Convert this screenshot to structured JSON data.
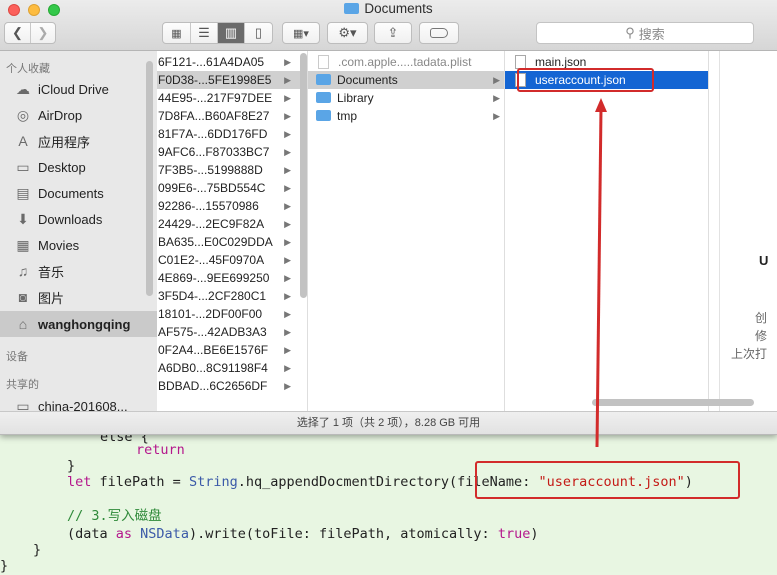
{
  "window": {
    "title": "Documents"
  },
  "toolbar": {
    "search_placeholder": "搜索"
  },
  "sidebar": {
    "favorites_header": "个人收藏",
    "devices_header": "设备",
    "shared_header": "共享的",
    "items": [
      {
        "label": "iCloud Drive",
        "icon": "☁"
      },
      {
        "label": "AirDrop",
        "icon": "◎"
      },
      {
        "label": "应用程序",
        "icon": "A"
      },
      {
        "label": "Desktop",
        "icon": "▭"
      },
      {
        "label": "Documents",
        "icon": "▤"
      },
      {
        "label": "Downloads",
        "icon": "⬇"
      },
      {
        "label": "Movies",
        "icon": "▦"
      },
      {
        "label": "音乐",
        "icon": "♫"
      },
      {
        "label": "图片",
        "icon": "◙"
      },
      {
        "label": "wanghongqing",
        "icon": "⌂"
      }
    ],
    "shared_item": "china-201608..."
  },
  "column1": {
    "rows": [
      "6F121-...61A4DA05",
      "F0D38-...5FE1998E5",
      "44E95-...217F97DEE",
      "7D8FA...B60AF8E27",
      "81F7A-...6DD176FD",
      "9AFC6...F87033BC7",
      "7F3B5-...5199888D",
      "099E6-...75BD554C",
      "92286-...15570986",
      "24429-...2EC9F82A",
      "BA635...E0C029DDA",
      "C01E2-...45F0970A",
      "4E869-...9EE699250",
      "3F5D4-...2CF280C1",
      "18101-...2DF00F00",
      "AF575-...42ADB3A3",
      "0F2A4...BE6E1576F",
      "A6DB0...8C91198F4",
      "BDBAD...6C2656DF"
    ]
  },
  "column2": {
    "rows": [
      {
        "label": ".com.apple.....tadata.plist",
        "kind": "file"
      },
      {
        "label": "Documents",
        "kind": "folder"
      },
      {
        "label": "Library",
        "kind": "folder"
      },
      {
        "label": "tmp",
        "kind": "folder"
      }
    ]
  },
  "column3": {
    "rows": [
      {
        "label": "main.json"
      },
      {
        "label": "useraccount.json"
      }
    ]
  },
  "preview": {
    "letter": "U",
    "line1": "创",
    "line2": "修",
    "line3": "上次打"
  },
  "status_bar": {
    "text": "选择了 1 项（共 2 项），8.28 GB 可用"
  },
  "code": {
    "l1": "else {",
    "l2": "return",
    "l3": "}",
    "l4_kw": "let",
    "l4_a": " filePath = ",
    "l4_ty": "String",
    "l4_b": ".hq_appendDocmentDirectory(fileName: ",
    "l4_str": "\"useraccount.json\"",
    "l4_c": ")",
    "l5": "// 3.写入磁盘",
    "l6_a": "(data ",
    "l6_kw": "as",
    "l6_ty": " NSData",
    "l6_b": ").write(toFile: filePath, atomically: ",
    "l6_kw2": "true",
    "l6_c": ")",
    "l7": "}",
    "l8": "}"
  },
  "colors": {
    "selection": "#1465d3",
    "annotation_red": "#d22b2b"
  }
}
